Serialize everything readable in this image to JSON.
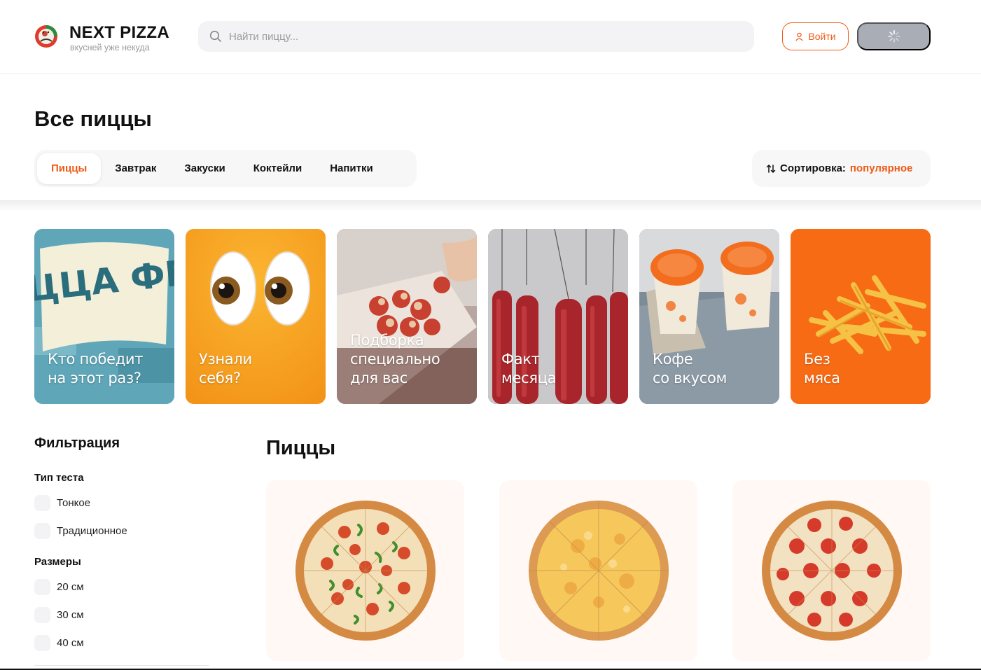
{
  "header": {
    "brand_title": "NEXT PIZZA",
    "brand_subtitle": "вкусней уже некуда",
    "search_placeholder": "Найти пиццу...",
    "login_label": "Войти",
    "logo_icon": "pizza-logo-icon",
    "accent_color": "#f05a14"
  },
  "page_title": "Все пиццы",
  "categories": [
    "Пиццы",
    "Завтрак",
    "Закуски",
    "Коктейли",
    "Напитки"
  ],
  "active_category": "Пиццы",
  "sort": {
    "label": "Сортировка:",
    "value": "популярное"
  },
  "stories": [
    {
      "caption": "Кто победит\nна этот раз?",
      "art_text": "ПИЦЦА ФЕСТ",
      "bg": "#5fa6b9"
    },
    {
      "caption": "Узнали\nсебя?",
      "bg": "#f8a51c"
    },
    {
      "caption": "Подборка\nспециально\nдля вас",
      "bg": "#8a3b30"
    },
    {
      "caption": "Факт\nмесяца",
      "bg": "#9c2424"
    },
    {
      "caption": "Кофе\nсо вкусом",
      "bg": "#6f7f8c"
    },
    {
      "caption": "Без\nмяса",
      "bg": "#f76b15"
    }
  ],
  "filters": {
    "title": "Фильтрация",
    "dough_title": "Тип теста",
    "dough_options": [
      "Тонкое",
      "Традиционное"
    ],
    "sizes_title": "Размеры",
    "size_options": [
      "20 см",
      "30 см",
      "40 см"
    ]
  },
  "products_section_title": "Пиццы",
  "products": [
    {
      "image": "pepperoni-pepper-pizza"
    },
    {
      "image": "cheese-pizza"
    },
    {
      "image": "pepperoni-pizza"
    }
  ]
}
